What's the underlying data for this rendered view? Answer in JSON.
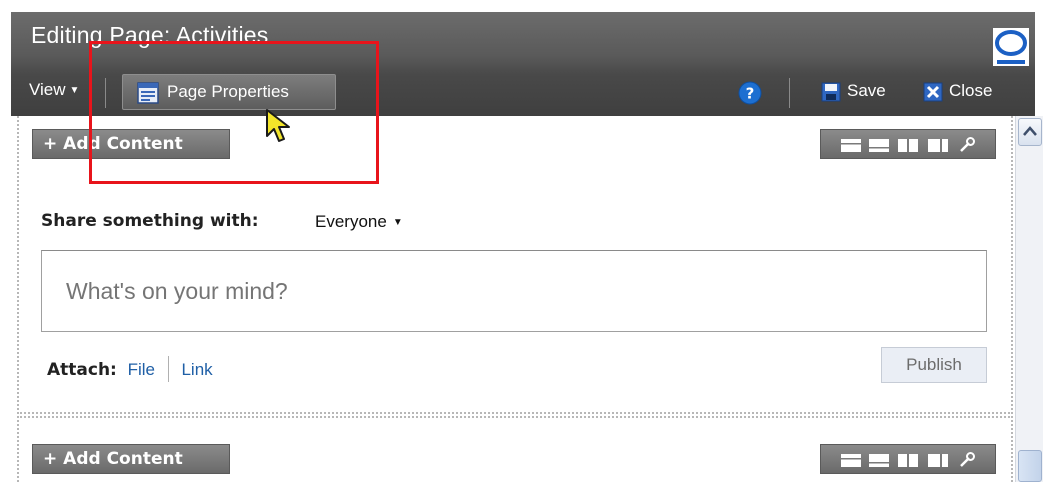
{
  "header": {
    "title": "Editing Page: Activities",
    "toolbar": {
      "view_label": "View",
      "page_properties_label": "Page Properties",
      "save_label": "Save",
      "close_label": "Close"
    }
  },
  "content": {
    "add_content_label": "+ Add Content",
    "share": {
      "label": "Share something with:",
      "audience": "Everyone"
    },
    "status_input_placeholder": "What's on your mind?",
    "attach": {
      "label": "Attach:",
      "file_link": "File",
      "link_link": "Link"
    },
    "publish_label": "Publish"
  },
  "icons": {
    "logo": "oracle-logo-icon",
    "help": "help-icon",
    "save": "floppy-disk-icon",
    "close": "close-x-icon",
    "page_properties": "page-properties-icon"
  },
  "colors": {
    "header_bg": "#4d4d4d",
    "highlight": "#e8141b",
    "link": "#1f5fa6",
    "help_blue": "#1d6fd1"
  }
}
